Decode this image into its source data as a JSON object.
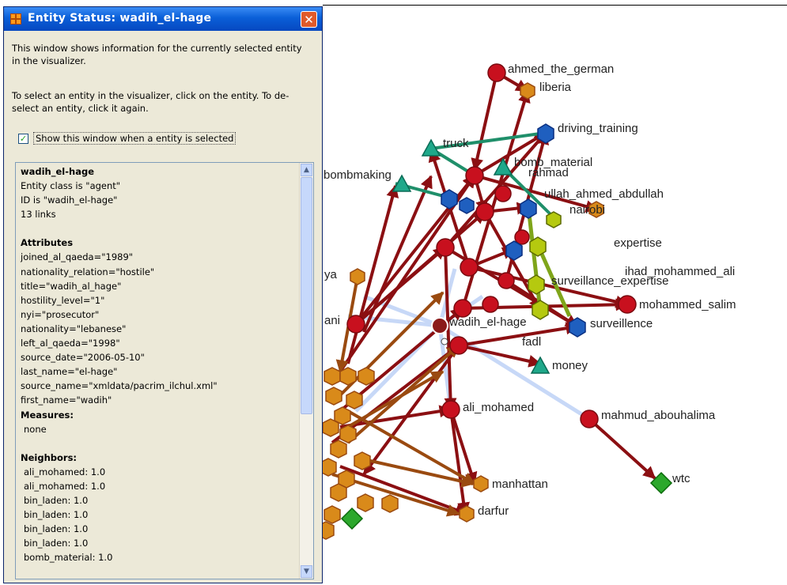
{
  "window": {
    "title": "Entity Status: wadih_el-hage",
    "close_icon": "✕",
    "intro_1": "This window shows information for the currently selected entity in the visualizer.",
    "intro_2": "To select an entity in the visualizer, click on the entity. To de-select an entity, click it again.",
    "show_checkbox": {
      "label": "Show this window when a entity is selected",
      "checked": true
    }
  },
  "entity": {
    "name": "wadih_el-hage",
    "class_line": "Entity class is \"agent\"",
    "id_line": "ID is \"wadih_el-hage\"",
    "links_line": "13 links",
    "attributes_heading": "Attributes",
    "attributes": [
      "joined_al_qaeda=\"1989\"",
      "nationality_relation=\"hostile\"",
      "title=\"wadih_al_hage\"",
      "hostility_level=\"1\"",
      "nyi=\"prosecutor\"",
      "nationality=\"lebanese\"",
      "left_al_qaeda=\"1998\"",
      "source_date=\"2006-05-10\"",
      "last_name=\"el-hage\"",
      "source_name=\"xmldata/pacrim_ilchul.xml\"",
      "first_name=\"wadih\""
    ],
    "measures_heading": "Measures:",
    "measures_value": "none",
    "neighbors_heading": "Neighbors:",
    "neighbors": [
      "ali_mohamed: 1.0",
      "ali_mohamed: 1.0",
      "bin_laden: 1.0",
      "bin_laden: 1.0",
      "bin_laden: 1.0",
      "bin_laden: 1.0",
      "bomb_material: 1.0"
    ]
  },
  "graph_labels": {
    "ahmed_the_german": "ahmed_the_german",
    "liberia": "liberia",
    "driving_training": "driving_training",
    "truck": "truck",
    "bomb_material": "bomb_material",
    "bombmaking": "bombmaking",
    "rahmad": "rahmad",
    "ullah_ahmed_abdullah": "ullah_ahmed_abdullah",
    "nairobi": "nairobi",
    "expertise": "expertise",
    "ihad_mohammed_ali": "ihad_mohammed_ali",
    "surveillance_expertise": "surveillance_expertise",
    "mohammed_salim": "mohammed_salim",
    "surveillence": "surveillence",
    "wadih_el_hage": "wadih_el-hage",
    "fadl": "fadl",
    "money": "money",
    "ali_mohamed": "ali_mohamed",
    "mahmud_abouhalima": "mahmud_abouhalima",
    "wtc": "wtc",
    "manhattan": "manhattan",
    "darfur": "darfur",
    "ya": "ya",
    "ani": "ani"
  },
  "colors": {
    "agent_node": "#c8101e",
    "agent_edge": "#8b0f12",
    "location_node": "#d98a1a",
    "location_edge": "#9a4a10",
    "knowledge_node": "#1f5fbf",
    "task_node": "#1fa88a",
    "resource_node": "#b5c90f",
    "target_node": "#2ca82c",
    "highlight_edge": "#c7d8f7",
    "titlebar": "#0a5fd8"
  }
}
